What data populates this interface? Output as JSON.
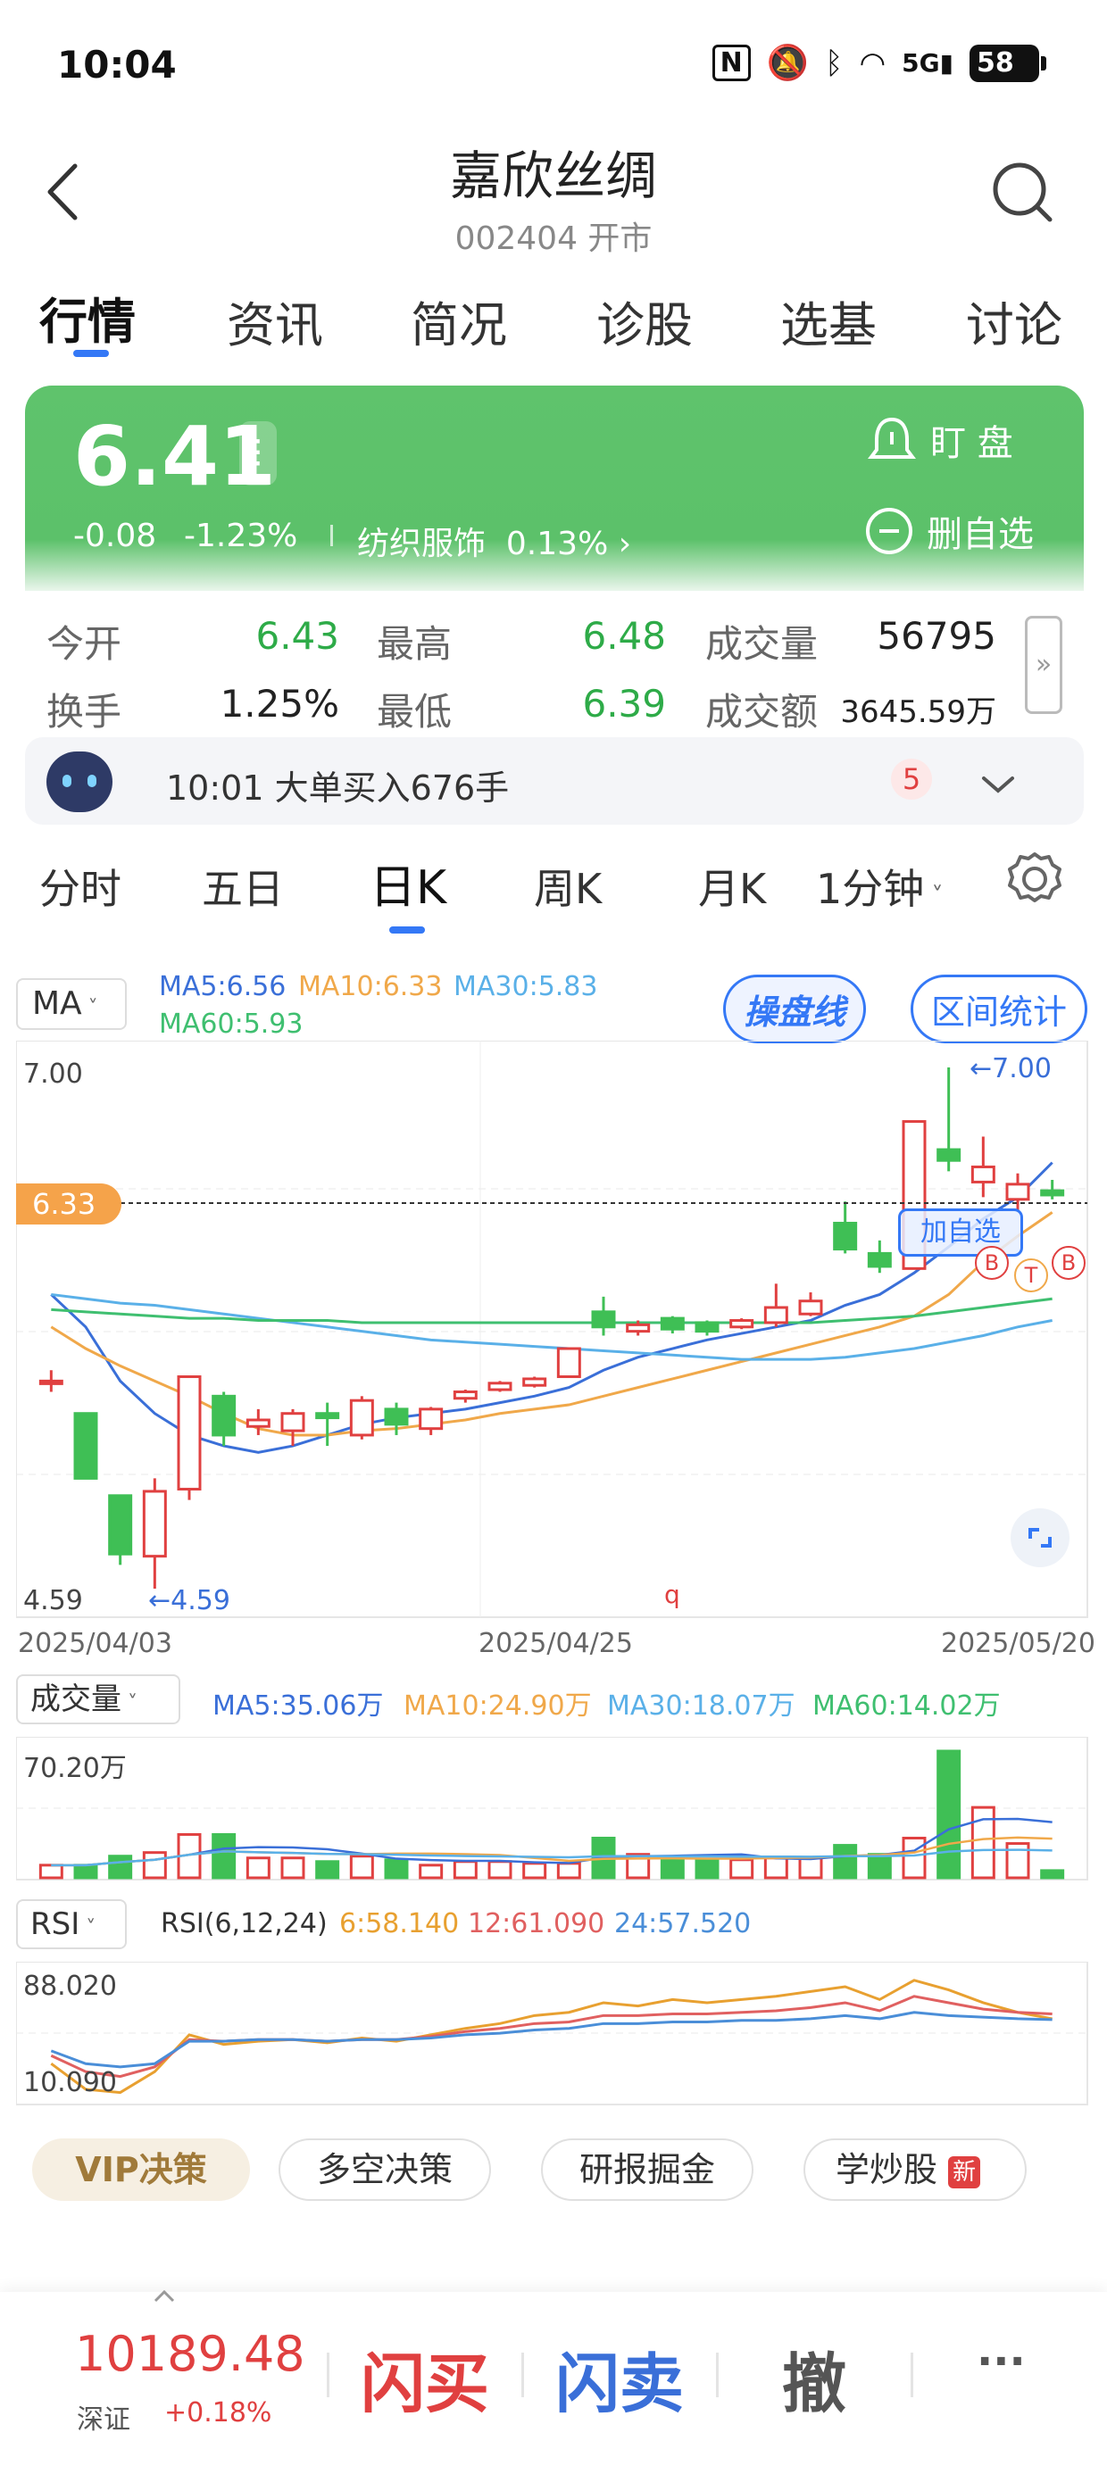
{
  "status_bar": {
    "time": "10:04",
    "battery": "58",
    "network": "5G"
  },
  "header": {
    "title": "嘉欣丝绸",
    "subtitle": "002404 开市"
  },
  "tabs": [
    "行情",
    "资讯",
    "简况",
    "诊股",
    "选基",
    "讨论"
  ],
  "quote": {
    "price": "6.41",
    "change": "-0.08",
    "change_pct": "-1.23%",
    "sector": "纺织服饰",
    "sector_pct": "0.13%",
    "watch_label": "盯 盘",
    "remove_label": "删自选"
  },
  "stats": {
    "open_label": "今开",
    "open": "6.43",
    "high_label": "最高",
    "high": "6.48",
    "volume_label": "成交量",
    "volume": "56795",
    "turnover_label": "换手",
    "turnover": "1.25%",
    "low_label": "最低",
    "low": "6.39",
    "amount_label": "成交额",
    "amount": "3645.59万"
  },
  "ticker": {
    "text": "10:01 大单买入676手",
    "count": "5"
  },
  "period_tabs": [
    "分时",
    "五日",
    "日K",
    "周K",
    "月K",
    "1分钟"
  ],
  "ma": {
    "selector": "MA",
    "ma5": "MA5:6.56",
    "ma10": "MA10:6.33",
    "ma30": "MA30:5.83",
    "ma60": "MA60:5.93",
    "btn1": "操盘线",
    "btn2": "区间统计"
  },
  "kline": {
    "y_max_label": "7.00",
    "y_min_label": "4.59",
    "price_tag": "6.33",
    "high_mark": "←7.00",
    "low_mark": "←4.59",
    "dates": [
      "2025/04/03",
      "2025/04/25",
      "2025/05/20"
    ],
    "add_watch": "加自选",
    "q_mark": "q"
  },
  "volume": {
    "selector": "成交量",
    "ma5": "MA5:35.06万",
    "ma10": "MA10:24.90万",
    "ma30": "MA30:18.07万",
    "ma60": "MA60:14.02万",
    "max_label": "70.20万"
  },
  "rsi": {
    "selector": "RSI",
    "params": "RSI(6,12,24)",
    "r6": "6:58.140",
    "r12": "12:61.090",
    "r24": "24:57.520",
    "max_label": "88.020",
    "min_label": "10.090"
  },
  "chips": [
    "VIP决策",
    "多空决策",
    "研报掘金",
    "学炒股"
  ],
  "chip_badge": "新",
  "bottom": {
    "index_value": "10189.48",
    "index_name": "深证",
    "index_pct": "+0.18%",
    "buy": "闪买",
    "sell": "闪卖",
    "cancel": "撤",
    "more": "···"
  },
  "colors": {
    "up": "#e04040",
    "down": "#3fbf55",
    "accent": "#3478f6",
    "ma5": "#3a6fd8",
    "ma10": "#f0a84a",
    "ma30": "#5ab0e8",
    "ma60": "#3fbf70"
  },
  "chart_data": {
    "type": "candlestick",
    "ylim": [
      4.59,
      7.0
    ],
    "candles": [
      {
        "o": 5.55,
        "c": 5.55,
        "h": 5.6,
        "l": 5.5
      },
      {
        "o": 5.4,
        "c": 5.1,
        "h": 5.4,
        "l": 5.1
      },
      {
        "o": 5.02,
        "c": 4.75,
        "h": 5.02,
        "l": 4.7
      },
      {
        "o": 4.74,
        "c": 5.04,
        "h": 5.1,
        "l": 4.59
      },
      {
        "o": 5.05,
        "c": 5.57,
        "h": 5.57,
        "l": 5.0
      },
      {
        "o": 5.48,
        "c": 5.3,
        "h": 5.5,
        "l": 5.25
      },
      {
        "o": 5.34,
        "c": 5.37,
        "h": 5.42,
        "l": 5.3
      },
      {
        "o": 5.32,
        "c": 5.4,
        "h": 5.42,
        "l": 5.25
      },
      {
        "o": 5.4,
        "c": 5.38,
        "h": 5.45,
        "l": 5.25
      },
      {
        "o": 5.3,
        "c": 5.46,
        "h": 5.48,
        "l": 5.28
      },
      {
        "o": 5.42,
        "c": 5.35,
        "h": 5.45,
        "l": 5.3
      },
      {
        "o": 5.33,
        "c": 5.42,
        "h": 5.43,
        "l": 5.3
      },
      {
        "o": 5.47,
        "c": 5.5,
        "h": 5.51,
        "l": 5.45
      },
      {
        "o": 5.51,
        "c": 5.54,
        "h": 5.55,
        "l": 5.5
      },
      {
        "o": 5.53,
        "c": 5.56,
        "h": 5.57,
        "l": 5.52
      },
      {
        "o": 5.57,
        "c": 5.7,
        "h": 5.7,
        "l": 5.57
      },
      {
        "o": 5.87,
        "c": 5.8,
        "h": 5.94,
        "l": 5.76
      },
      {
        "o": 5.78,
        "c": 5.81,
        "h": 5.83,
        "l": 5.76
      },
      {
        "o": 5.84,
        "c": 5.79,
        "h": 5.85,
        "l": 5.77
      },
      {
        "o": 5.82,
        "c": 5.78,
        "h": 5.83,
        "l": 5.76
      },
      {
        "o": 5.8,
        "c": 5.83,
        "h": 5.84,
        "l": 5.79
      },
      {
        "o": 5.82,
        "c": 5.89,
        "h": 6.0,
        "l": 5.8
      },
      {
        "o": 5.86,
        "c": 5.92,
        "h": 5.96,
        "l": 5.85
      },
      {
        "o": 6.28,
        "c": 6.16,
        "h": 6.38,
        "l": 6.14
      },
      {
        "o": 6.14,
        "c": 6.08,
        "h": 6.2,
        "l": 6.05
      },
      {
        "o": 6.07,
        "c": 6.75,
        "h": 6.75,
        "l": 6.07
      },
      {
        "o": 6.62,
        "c": 6.57,
        "h": 7.0,
        "l": 6.52
      },
      {
        "o": 6.47,
        "c": 6.54,
        "h": 6.68,
        "l": 6.4
      },
      {
        "o": 6.39,
        "c": 6.46,
        "h": 6.51,
        "l": 6.34
      },
      {
        "o": 6.43,
        "c": 6.41,
        "h": 6.48,
        "l": 6.39
      }
    ],
    "ma_lines": {
      "MA5": [
        5.95,
        5.8,
        5.55,
        5.4,
        5.3,
        5.25,
        5.22,
        5.25,
        5.3,
        5.35,
        5.38,
        5.4,
        5.42,
        5.45,
        5.48,
        5.52,
        5.6,
        5.66,
        5.7,
        5.74,
        5.77,
        5.8,
        5.83,
        5.9,
        5.95,
        6.05,
        6.17,
        6.3,
        6.4,
        6.56
      ],
      "MA10": [
        5.8,
        5.7,
        5.62,
        5.55,
        5.48,
        5.4,
        5.33,
        5.3,
        5.3,
        5.32,
        5.33,
        5.35,
        5.37,
        5.4,
        5.42,
        5.44,
        5.48,
        5.52,
        5.56,
        5.6,
        5.64,
        5.68,
        5.72,
        5.76,
        5.8,
        5.85,
        5.95,
        6.1,
        6.22,
        6.33
      ],
      "MA30": [
        5.95,
        5.93,
        5.91,
        5.9,
        5.88,
        5.86,
        5.84,
        5.82,
        5.8,
        5.78,
        5.76,
        5.74,
        5.73,
        5.72,
        5.71,
        5.7,
        5.69,
        5.68,
        5.67,
        5.66,
        5.65,
        5.65,
        5.65,
        5.66,
        5.68,
        5.7,
        5.73,
        5.76,
        5.8,
        5.83
      ],
      "MA60": [
        5.88,
        5.87,
        5.86,
        5.85,
        5.84,
        5.84,
        5.83,
        5.83,
        5.83,
        5.82,
        5.82,
        5.82,
        5.82,
        5.82,
        5.82,
        5.82,
        5.82,
        5.82,
        5.82,
        5.82,
        5.82,
        5.82,
        5.82,
        5.83,
        5.84,
        5.85,
        5.87,
        5.89,
        5.91,
        5.93
      ]
    },
    "volume_values_wan": [
      7,
      7,
      12,
      14,
      24,
      24,
      11,
      11,
      9,
      12,
      10,
      7,
      9,
      9,
      8,
      8,
      22,
      13,
      10,
      10,
      10,
      11,
      11,
      18,
      13,
      22,
      70.2,
      39,
      19,
      4
    ],
    "volume_max": 70.2,
    "rsi_lines": {
      "RSI6": [
        30,
        14,
        12,
        25,
        48,
        42,
        44,
        45,
        43,
        46,
        44,
        48,
        52,
        55,
        60,
        62,
        68,
        66,
        70,
        68,
        70,
        72,
        75,
        78,
        70,
        82,
        76,
        68,
        62,
        58
      ],
      "RSI12": [
        35,
        25,
        22,
        28,
        45,
        44,
        45,
        45,
        44,
        45,
        45,
        47,
        50,
        52,
        55,
        56,
        60,
        60,
        61,
        61,
        62,
        63,
        65,
        68,
        63,
        72,
        68,
        64,
        62,
        61
      ],
      "RSI24": [
        38,
        30,
        28,
        30,
        44,
        44,
        45,
        45,
        44,
        45,
        45,
        46,
        48,
        49,
        51,
        52,
        55,
        55,
        56,
        56,
        57,
        57,
        58,
        60,
        58,
        62,
        60,
        59,
        58,
        57.5
      ]
    },
    "rsi_range": [
      10.09,
      88.02
    ]
  }
}
